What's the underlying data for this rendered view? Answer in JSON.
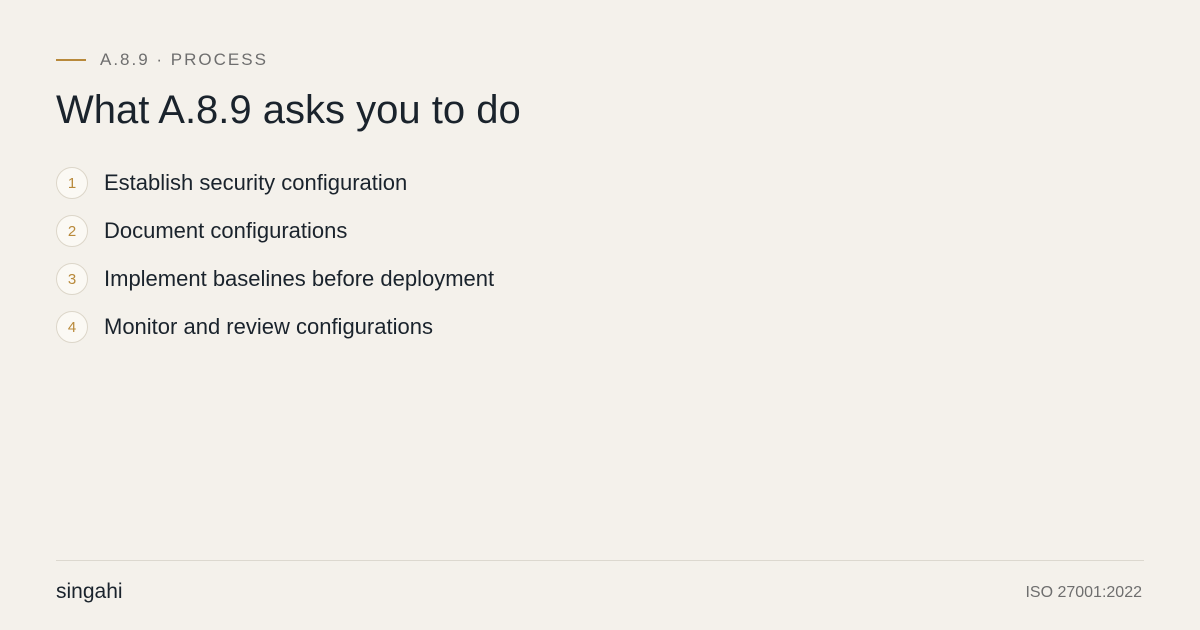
{
  "header": {
    "eyebrow": "A.8.9 · PROCESS",
    "title": "What A.8.9 asks you to do"
  },
  "steps": [
    {
      "number": "1",
      "label": "Establish security configuration"
    },
    {
      "number": "2",
      "label": "Document configurations"
    },
    {
      "number": "3",
      "label": "Implement baselines before deployment"
    },
    {
      "number": "4",
      "label": "Monitor and review configurations"
    }
  ],
  "footer": {
    "brand": "singahi",
    "standard": "ISO 27001:2022"
  },
  "colors": {
    "background": "#f4f1eb",
    "accent": "#b8893a",
    "text": "#1a232c",
    "muted": "#6e6e6e"
  }
}
